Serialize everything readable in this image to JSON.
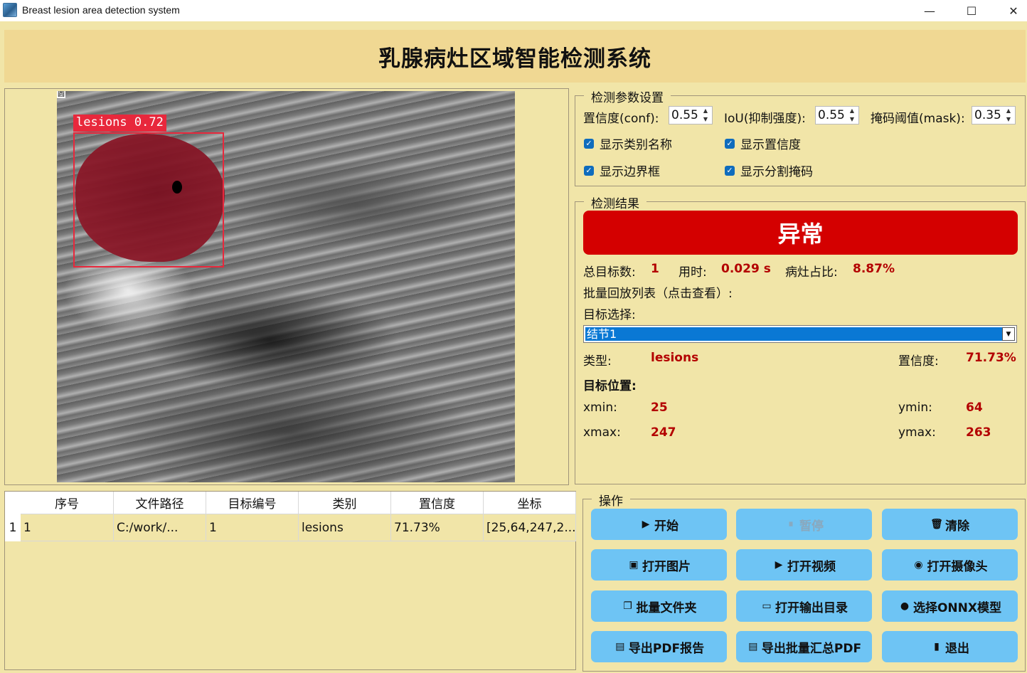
{
  "window": {
    "title": "Breast lesion area detection system",
    "min_glyph": "—",
    "max_glyph": "☐",
    "close_glyph": "✕"
  },
  "header": {
    "title": "乳腺病灶区域智能检测系统"
  },
  "image": {
    "corner_mark": "圆",
    "detection_label": "lesions  0.72"
  },
  "params": {
    "group_title": "检测参数设置",
    "conf_label": "置信度(conf):",
    "conf_value": "0.55",
    "iou_label": "IoU(抑制强度):",
    "iou_value": "0.55",
    "mask_label": "掩码阈值(mask):",
    "mask_value": "0.35",
    "checkboxes": [
      {
        "label": "显示类别名称",
        "checked": true
      },
      {
        "label": "显示置信度",
        "checked": true
      },
      {
        "label": "显示边界框",
        "checked": true
      },
      {
        "label": "显示分割掩码",
        "checked": true
      }
    ]
  },
  "result": {
    "group_title": "检测结果",
    "status": "异常",
    "total_label": "总目标数:",
    "total_value": "1",
    "time_label": "用时:",
    "time_value": "0.029 s",
    "ratio_label": "病灶占比:",
    "ratio_value": "8.87%",
    "batch_label": "批量回放列表（点击查看）:",
    "target_select_label": "目标选择:",
    "target_selected": "结节1",
    "type_label": "类型:",
    "type_value": "lesions",
    "conf_label": "置信度:",
    "conf_value": "71.73%",
    "position_label": "目标位置:",
    "xmin_label": "xmin:",
    "xmin_value": "25",
    "ymin_label": "ymin:",
    "ymin_value": "64",
    "xmax_label": "xmax:",
    "xmax_value": "247",
    "ymax_label": "ymax:",
    "ymax_value": "263"
  },
  "table": {
    "headers": [
      "序号",
      "文件路径",
      "目标编号",
      "类别",
      "置信度",
      "坐标"
    ],
    "row_numbers": [
      "1"
    ],
    "rows": [
      [
        "1",
        "C:/work/...",
        "1",
        "lesions",
        "71.73%",
        "[25,64,247,2..."
      ]
    ]
  },
  "actions": {
    "group_title": "操作",
    "buttons": [
      {
        "label": "开始",
        "icon": "play-icon"
      },
      {
        "label": "暂停",
        "icon": "pause-icon",
        "disabled": true
      },
      {
        "label": "清除",
        "icon": "trash-icon"
      },
      {
        "label": "打开图片",
        "icon": "image-icon"
      },
      {
        "label": "打开视频",
        "icon": "video-icon"
      },
      {
        "label": "打开摄像头",
        "icon": "webcam-icon"
      },
      {
        "label": "批量文件夹",
        "icon": "copy-folder-icon"
      },
      {
        "label": "打开输出目录",
        "icon": "folder-icon"
      },
      {
        "label": "选择ONNX模型",
        "icon": "model-icon"
      },
      {
        "label": "导出PDF报告",
        "icon": "pdf-icon"
      },
      {
        "label": "导出批量汇总PDF",
        "icon": "pdf-batch-icon"
      },
      {
        "label": "退出",
        "icon": "exit-icon"
      }
    ]
  },
  "colors": {
    "background": "#f1e5a8",
    "header": "#f0d893",
    "status_red": "#d40000",
    "value_red": "#b30000",
    "button_blue": "#6ec4f4",
    "bbox_red": "#e8283c"
  }
}
